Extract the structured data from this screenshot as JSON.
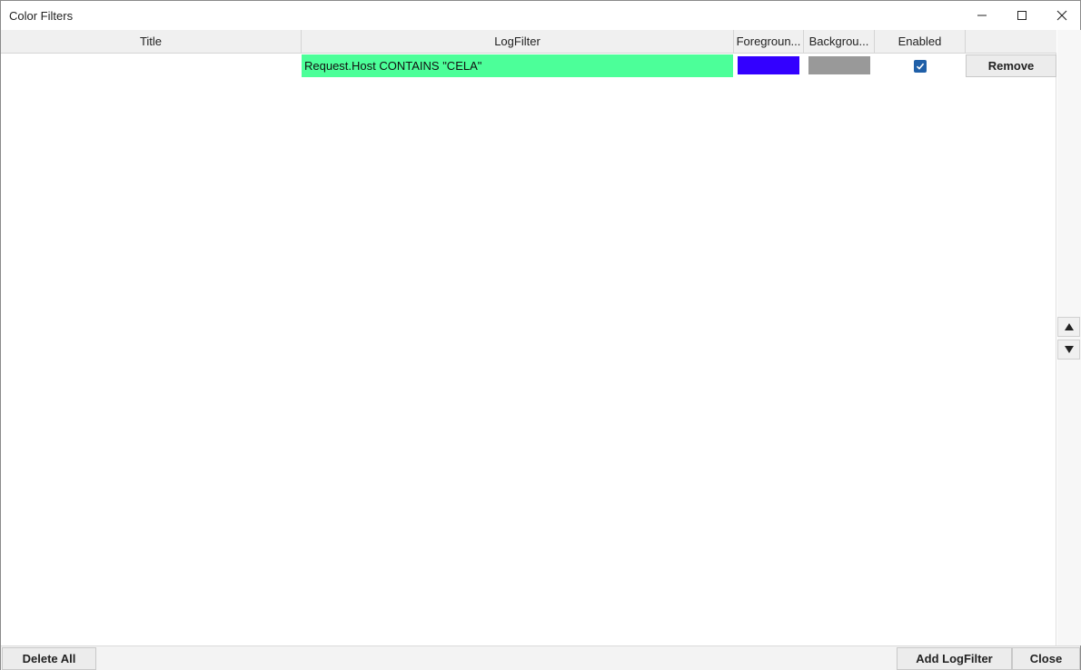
{
  "window": {
    "title": "Color Filters",
    "controls": {
      "minimize": "minimize-icon",
      "maximize": "maximize-icon",
      "close": "close-icon"
    }
  },
  "grid": {
    "columns": [
      "Title",
      "LogFilter",
      "Foregroun...",
      "Backgrou...",
      "Enabled",
      ""
    ],
    "rows": [
      {
        "title": "",
        "logfilter": "Request.Host CONTAINS \"CELA\"",
        "logfilter_bg": "#4cff99",
        "foreground_color": "#3300ff",
        "background_color": "#999999",
        "enabled": true,
        "action_label": "Remove"
      }
    ]
  },
  "side": {
    "move_up": "triangle-up-icon",
    "move_down": "triangle-down-icon"
  },
  "footer": {
    "delete_all_label": "Delete All",
    "add_label": "Add LogFilter",
    "close_label": "Close"
  }
}
